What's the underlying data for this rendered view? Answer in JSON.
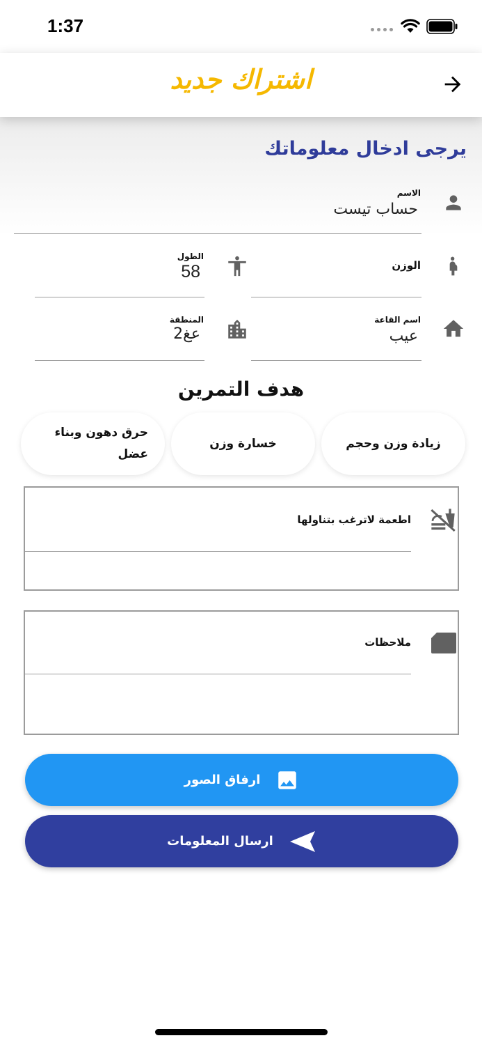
{
  "status_bar": {
    "time": "1:37"
  },
  "header": {
    "title": "اشتراك جديد"
  },
  "form": {
    "heading": "يرجى ادخال معلوماتك",
    "name": {
      "label": "الاسم",
      "value": "حساب تيست"
    },
    "weight": {
      "label": "الوزن",
      "value": ""
    },
    "height": {
      "label": "الطول",
      "value": "58"
    },
    "gym": {
      "label": "اسم القاعة",
      "value": "عيب"
    },
    "region": {
      "label": "المنطقة",
      "value": "عغ2"
    }
  },
  "goal": {
    "title": "هدف التمرين",
    "options": [
      "زيادة وزن وحجم",
      "خسارة وزن",
      "حرق دهون وبناء عضل"
    ]
  },
  "foods": {
    "label": "اطعمة لاترغب  بتناولها",
    "value": ""
  },
  "notes": {
    "label": "ملاحظات",
    "value": ""
  },
  "buttons": {
    "attach": "ارفاق الصور",
    "submit": "ارسال المعلومات"
  },
  "colors": {
    "title": "#f5b800",
    "heading": "#2f3c9a",
    "attach": "#2196f3",
    "submit": "#303f9f",
    "icon": "#616161"
  }
}
